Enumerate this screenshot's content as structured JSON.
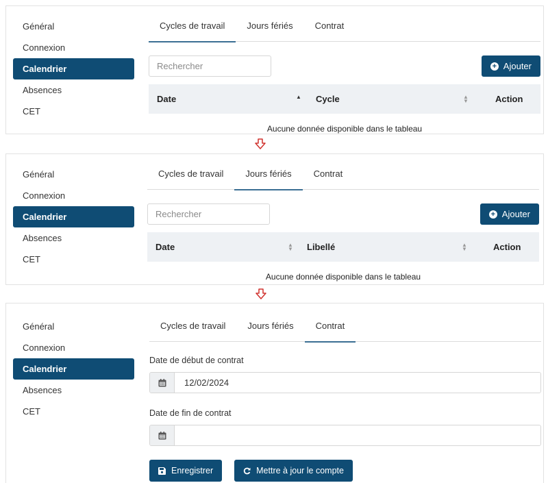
{
  "sidebar": {
    "items": [
      {
        "label": "Général"
      },
      {
        "label": "Connexion"
      },
      {
        "label": "Calendrier"
      },
      {
        "label": "Absences"
      },
      {
        "label": "CET"
      }
    ]
  },
  "tabs": {
    "cycles": "Cycles de travail",
    "holidays": "Jours fériés",
    "contract": "Contrat"
  },
  "search": {
    "placeholder": "Rechercher"
  },
  "add_button": {
    "label": "Ajouter",
    "icon": "plus-circle-icon"
  },
  "cycles_table": {
    "columns": [
      "Date",
      "Cycle",
      "Action"
    ],
    "empty": "Aucune donnée disponible dans le tableau"
  },
  "holidays_table": {
    "columns": [
      "Date",
      "Libellé",
      "Action"
    ],
    "empty": "Aucune donnée disponible dans le tableau"
  },
  "contract": {
    "start_label": "Date de début de contrat",
    "start_value": "12/02/2024",
    "end_label": "Date de fin de contrat",
    "end_value": "",
    "save_label": "Enregistrer",
    "update_label": "Mettre à jour le compte"
  },
  "colors": {
    "primary": "#0f4c74",
    "arrow": "#d0312d"
  }
}
